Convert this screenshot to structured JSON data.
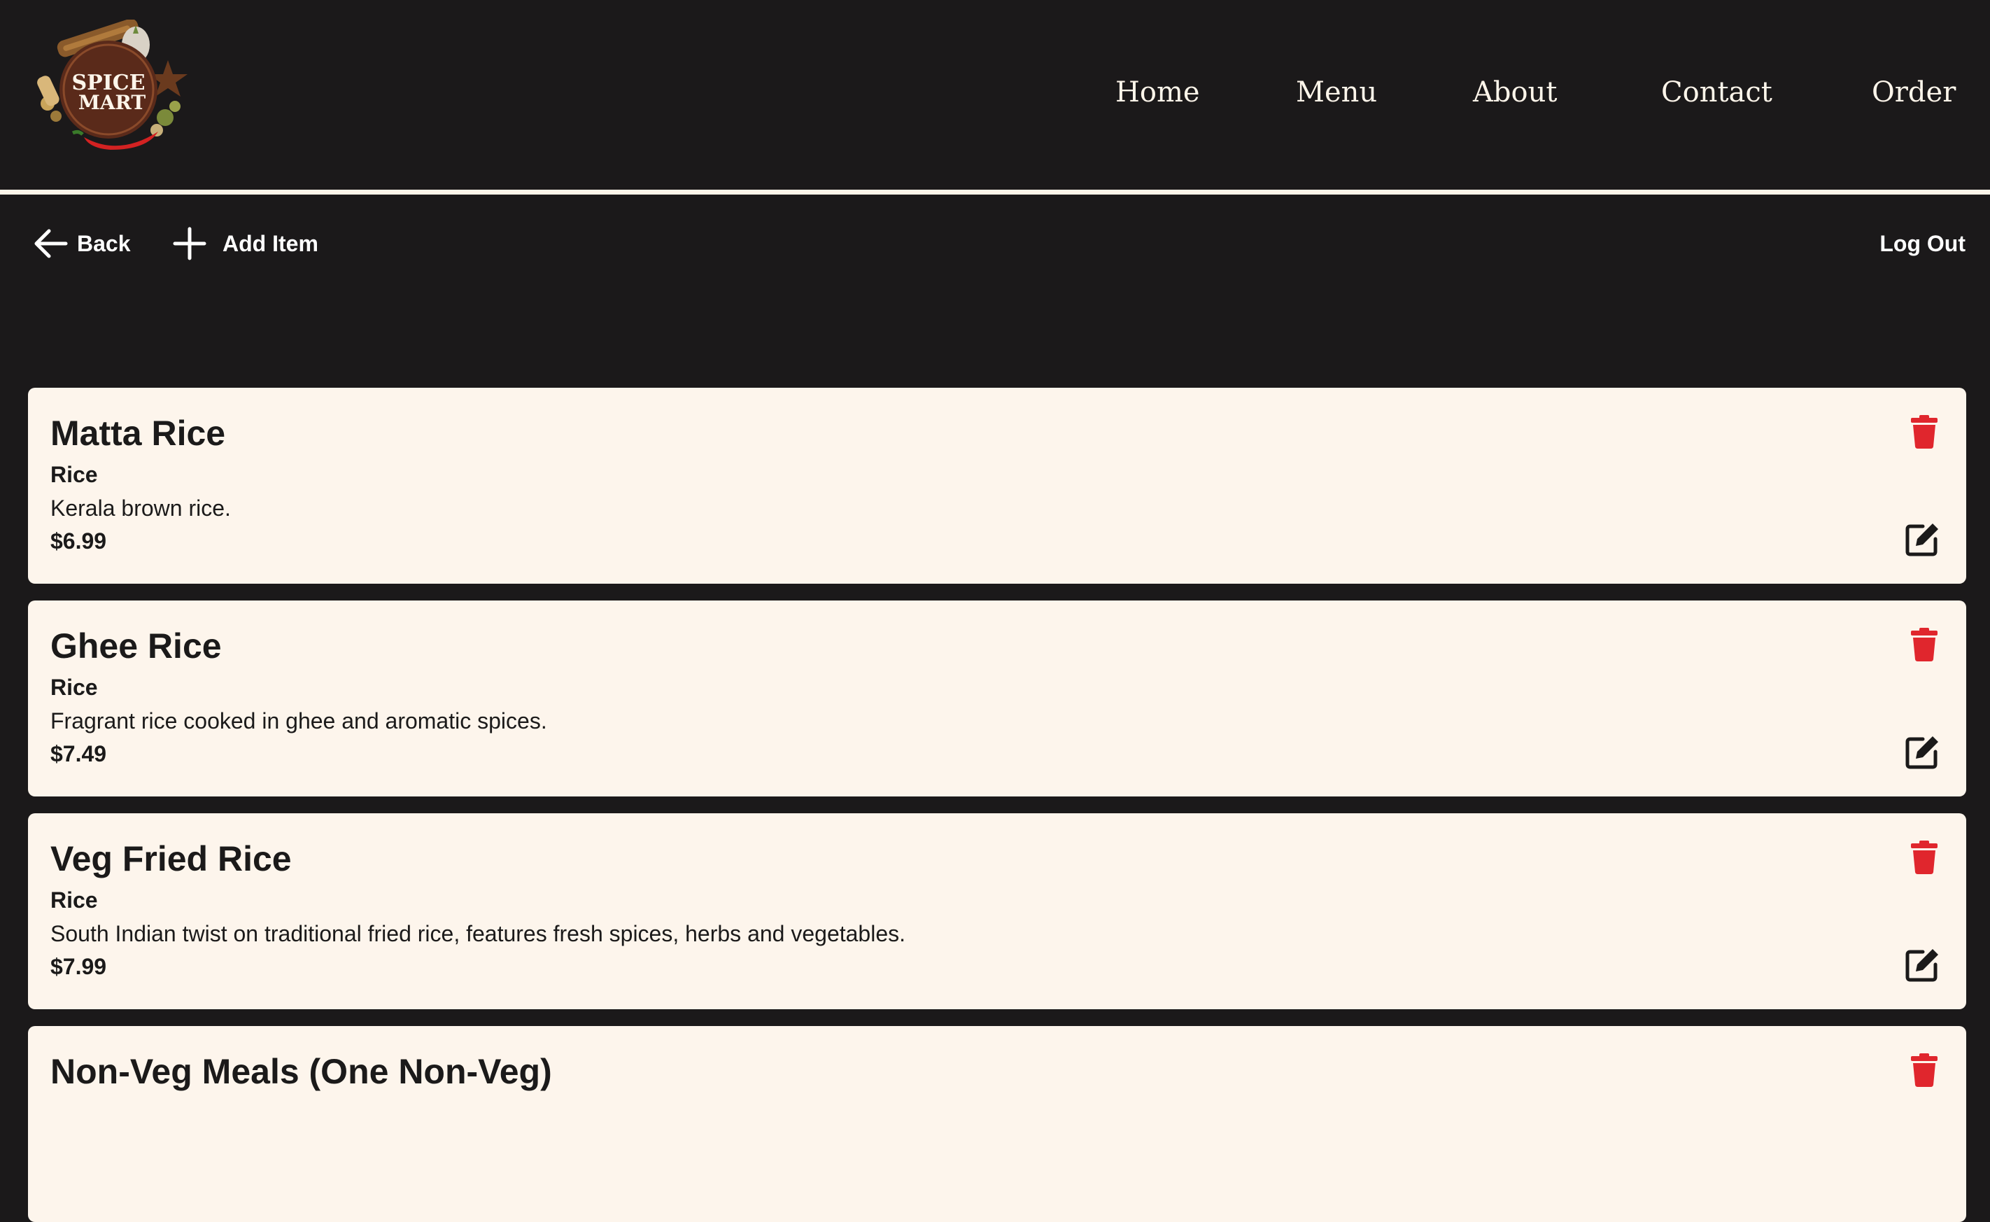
{
  "header": {
    "logo": {
      "brand_line1": "SPICE",
      "brand_line2": "MART"
    },
    "nav": [
      {
        "label": "Home"
      },
      {
        "label": "Menu"
      },
      {
        "label": "About"
      },
      {
        "label": "Contact"
      },
      {
        "label": "Order"
      }
    ]
  },
  "toolbar": {
    "back_label": "Back",
    "back_icon": "arrow-left-icon",
    "add_label": "Add Item",
    "add_icon": "plus-icon",
    "logout_label": "Log Out"
  },
  "items": [
    {
      "name": "Matta Rice",
      "category": "Rice",
      "description": "Kerala brown rice.",
      "price": "$6.99"
    },
    {
      "name": "Ghee Rice",
      "category": "Rice",
      "description": "Fragrant rice cooked in ghee and aromatic spices.",
      "price": "$7.49"
    },
    {
      "name": "Veg Fried Rice",
      "category": "Rice",
      "description": "South Indian twist on traditional fried rice, features fresh spices, herbs and vegetables.",
      "price": "$7.99"
    },
    {
      "name": "Non-Veg Meals (One Non-Veg)",
      "category": "",
      "description": "",
      "price": ""
    }
  ],
  "icons": {
    "delete": "trash-icon",
    "edit": "edit-icon"
  },
  "colors": {
    "background": "#1b191a",
    "card": "#fdf5ec",
    "delete_red": "#e0262d",
    "text_dark": "#1b1a1a",
    "text_light": "#fdf5ea"
  }
}
